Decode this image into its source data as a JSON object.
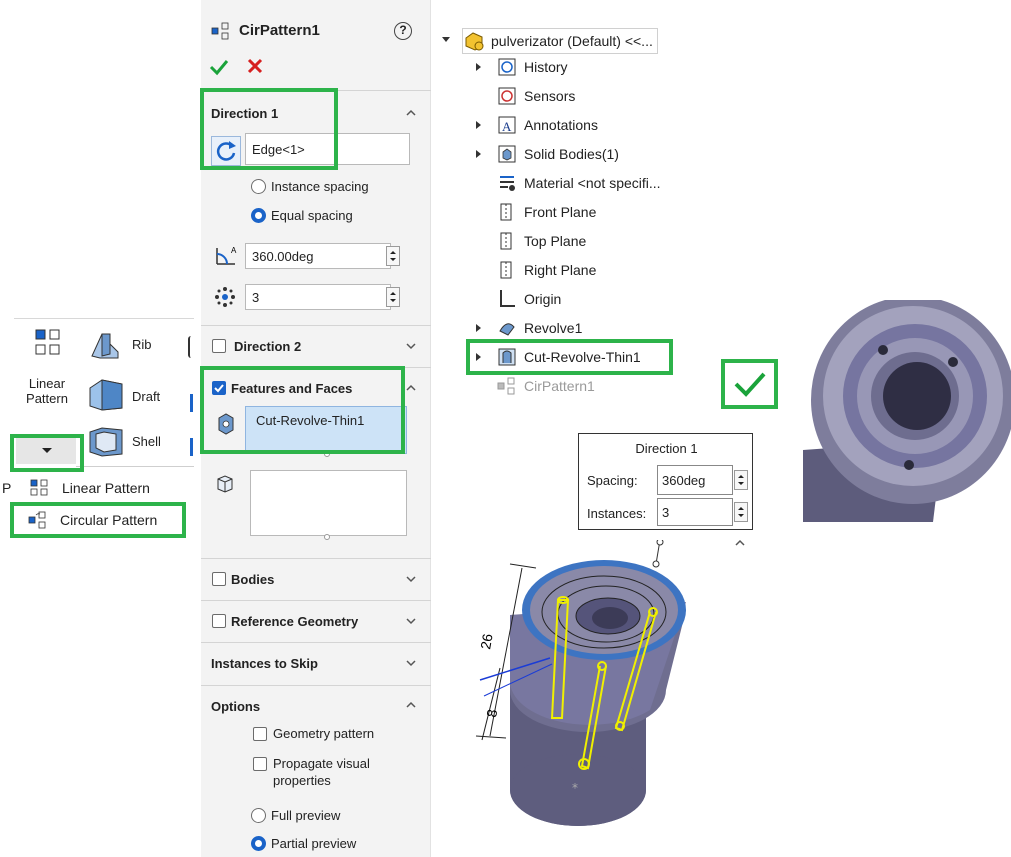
{
  "toolbar": {
    "linear_pattern_label": "Linear Pattern",
    "rib_label": "Rib",
    "draft_label": "Draft",
    "shell_label": "Shell",
    "dropdown_items": [
      "Linear Pattern",
      "Circular Pattern"
    ],
    "partial_letter": "P"
  },
  "property_manager": {
    "title": "CirPattern1",
    "help_symbol": "?",
    "direction1": {
      "header": "Direction 1",
      "edge_value": "Edge<1>",
      "instance_spacing_label": "Instance spacing",
      "equal_spacing_label": "Equal spacing",
      "selected_option": "Equal spacing",
      "angle_value": "360.00deg",
      "instances_value": "3"
    },
    "direction2_header": "Direction 2",
    "features_and_faces": {
      "header": "Features and Faces",
      "checked": true,
      "features_value": "Cut-Revolve-Thin1"
    },
    "bodies_header": "Bodies",
    "reference_geometry_header": "Reference Geometry",
    "instances_to_skip_header": "Instances to Skip",
    "options": {
      "header": "Options",
      "geometry_pattern_label": "Geometry pattern",
      "propagate_visual_label": "Propagate visual properties",
      "full_preview_label": "Full preview",
      "partial_preview_label": "Partial preview",
      "selected_preview": "Partial preview"
    }
  },
  "feature_tree": {
    "root": "pulverizator (Default) <<...",
    "items": [
      {
        "label": "History",
        "expandable": true
      },
      {
        "label": "Sensors",
        "expandable": false
      },
      {
        "label": "Annotations",
        "expandable": true
      },
      {
        "label": "Solid Bodies(1)",
        "expandable": true
      },
      {
        "label": "Material <not specifi...",
        "expandable": false
      },
      {
        "label": "Front Plane",
        "expandable": false
      },
      {
        "label": "Top Plane",
        "expandable": false
      },
      {
        "label": "Right Plane",
        "expandable": false
      },
      {
        "label": "Origin",
        "expandable": false
      },
      {
        "label": "Revolve1",
        "expandable": true
      },
      {
        "label": "Cut-Revolve-Thin1",
        "expandable": true
      },
      {
        "label": "CirPattern1",
        "expandable": false
      }
    ]
  },
  "popup": {
    "title": "Direction 1",
    "spacing_label": "Spacing:",
    "spacing_value": "360deg",
    "instances_label": "Instances:",
    "instances_value": "3"
  },
  "viewport": {
    "dim_26": "26",
    "dim_8": "8"
  },
  "colors": {
    "highlight_green": "#2db34a",
    "accent_blue": "#1a63c8",
    "part_body": "#7e7d9c",
    "preview_yellow": "#f0f000"
  }
}
